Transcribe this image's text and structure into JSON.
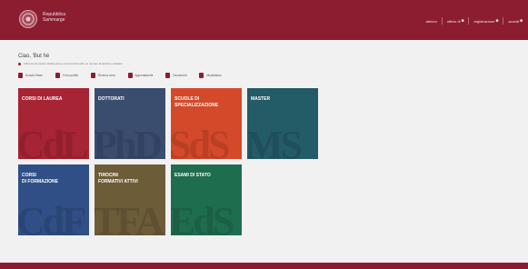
{
  "header": {
    "brand_line1": "Repubblica",
    "brand_line2": "Sammarge",
    "nav": [
      {
        "label": "ateneo",
        "icon": ""
      },
      {
        "label": "ufficio di",
        "icon": "user-icon"
      },
      {
        "label": "registrazione",
        "icon": "user-icon"
      },
      {
        "label": "accedi",
        "icon": "lock-icon"
      }
    ]
  },
  "page": {
    "title": "Ciao, 'But hé",
    "note": "Attiva la sicurezza relativa al tuo account fornendo un numero di telefono cellulare"
  },
  "quick_links": [
    {
      "label": "Scuola Tasse"
    },
    {
      "label": "Il mio profilo"
    },
    {
      "label": "Ricerca corsi"
    },
    {
      "label": "Appuntamenti"
    },
    {
      "label": "Documenti"
    },
    {
      "label": "Modulistica"
    }
  ],
  "tiles": [
    {
      "label": "Corsi di laurea",
      "watermark": "CdL",
      "color": "#a72434"
    },
    {
      "label": "Dottorati",
      "watermark": "PhD",
      "color": "#3a4d6f"
    },
    {
      "label": "Scuole di\nspecializzazione",
      "watermark": "SdS",
      "color": "#d4492a"
    },
    {
      "label": "Master",
      "watermark": "MS",
      "color": "#235b67"
    },
    {
      "label": "Corsi\ndi formazione",
      "watermark": "CdF",
      "color": "#304f86"
    },
    {
      "label": "Tirocini\nformativi attivi",
      "watermark": "TFA",
      "color": "#6c5c38"
    },
    {
      "label": "Esami di stato",
      "watermark": "EdS",
      "color": "#1f6d4f"
    }
  ]
}
